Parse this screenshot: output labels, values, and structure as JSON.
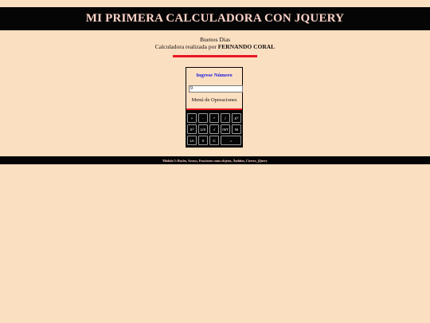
{
  "header": {
    "title": "MI PRIMERA CALCULADORA CON JQUERY"
  },
  "greeting": {
    "line1": "Buenos Dias",
    "line2_prefix": "Calculadora realizada por ",
    "author": "FERNANDO CORAL"
  },
  "calculator": {
    "title": "Ingrese Número",
    "display_value": "0",
    "menu_label": "Menú de Operaciones",
    "keys": {
      "add": "+",
      "subtract": "-",
      "multiply": "*",
      "divide": "/",
      "power_base": "X",
      "power_exp": "Y",
      "square_base": "X",
      "square_exp": "2",
      "reciprocal": "1/X",
      "sqrt": "√",
      "integer": "INT",
      "factorial": "N!",
      "ln": "Ln",
      "pi": "π",
      "clear": "C",
      "equals": "="
    }
  },
  "footer": {
    "text": "Módulo 5: Bucles, Arrays, Funciones como objetos, Ámbitos, Cierres, jQuery"
  },
  "colors": {
    "page_background": "#fbdfc1",
    "banner_background": "#050505",
    "banner_text": "#ffd3c8",
    "accent_red": "#e8161f",
    "title_blue": "#1a1adf"
  }
}
